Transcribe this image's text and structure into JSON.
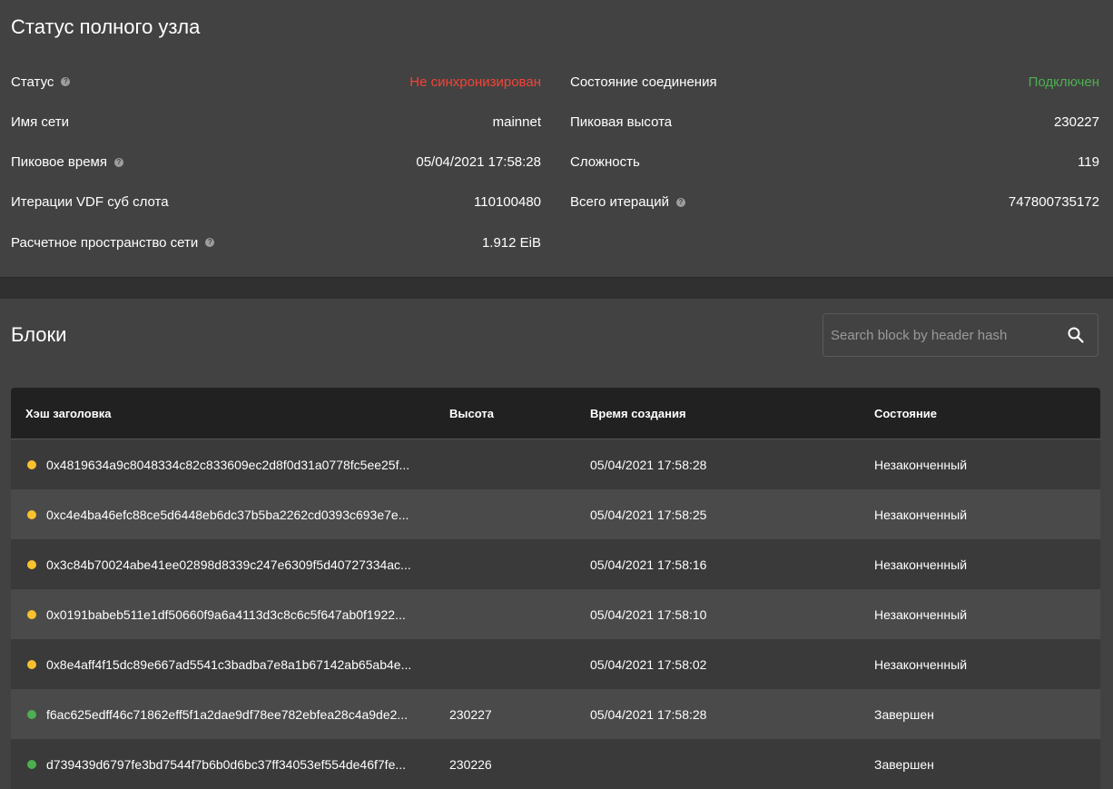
{
  "full_node": {
    "title": "Статус полного узла",
    "left": [
      {
        "label": "Статус",
        "help": true,
        "value": "Не синхронизирован",
        "tone": "red"
      },
      {
        "label": "Имя сети",
        "help": false,
        "value": "mainnet",
        "tone": "normal"
      },
      {
        "label": "Пиковое время",
        "help": true,
        "value": "05/04/2021 17:58:28",
        "tone": "normal"
      },
      {
        "label": "Итерации VDF суб слота",
        "help": false,
        "value": "110100480",
        "tone": "normal"
      },
      {
        "label": "Расчетное пространство сети",
        "help": true,
        "value": "1.912 EiB",
        "tone": "normal"
      }
    ],
    "right": [
      {
        "label": "Состояние соединения",
        "help": false,
        "value": "Подключен",
        "tone": "green"
      },
      {
        "label": "Пиковая высота",
        "help": false,
        "value": "230227",
        "tone": "normal"
      },
      {
        "label": "Сложность",
        "help": false,
        "value": "119",
        "tone": "normal"
      },
      {
        "label": "Всего итераций",
        "help": true,
        "value": "747800735172",
        "tone": "normal"
      }
    ],
    "help_glyph": "?"
  },
  "blocks": {
    "title": "Блоки",
    "search_placeholder": "Search block by header hash",
    "search_icon": "search-icon",
    "columns": {
      "hash": "Хэш заголовка",
      "height": "Высота",
      "time": "Время создания",
      "state": "Состояние"
    },
    "rows": [
      {
        "hash": "0x4819634a9c8048334c82c833609ec2d8f0d31a0778fc5ee25f...",
        "height": "",
        "time": "05/04/2021 17:58:28",
        "state": "Незаконченный",
        "dot": "#fbc02d"
      },
      {
        "hash": "0xc4e4ba46efc88ce5d6448eb6dc37b5ba2262cd0393c693e7e...",
        "height": "",
        "time": "05/04/2021 17:58:25",
        "state": "Незаконченный",
        "dot": "#fbc02d"
      },
      {
        "hash": "0x3c84b70024abe41ee02898d8339c247e6309f5d40727334ac...",
        "height": "",
        "time": "05/04/2021 17:58:16",
        "state": "Незаконченный",
        "dot": "#fbc02d"
      },
      {
        "hash": "0x0191babeb511e1df50660f9a6a4113d3c8c6c5f647ab0f1922...",
        "height": "",
        "time": "05/04/2021 17:58:10",
        "state": "Незаконченный",
        "dot": "#fbc02d"
      },
      {
        "hash": "0x8e4aff4f15dc89e667ad5541c3badba7e8a1b67142ab65ab4e...",
        "height": "",
        "time": "05/04/2021 17:58:02",
        "state": "Незаконченный",
        "dot": "#fbc02d"
      },
      {
        "hash": "f6ac625edff46c71862eff5f1a2dae9df78ee782ebfea28c4a9de2...",
        "height": "230227",
        "time": "05/04/2021 17:58:28",
        "state": "Завершен",
        "dot": "#4caf50"
      },
      {
        "hash": "d739439d6797fe3bd7544f7b6b0d6bc37ff34053ef554de46f7fe...",
        "height": "230226",
        "time": "",
        "state": "Завершен",
        "dot": "#4caf50"
      }
    ]
  },
  "colors": {
    "background": "#424242",
    "red": "#f44336",
    "green": "#4caf50",
    "pending": "#fbc02d",
    "header": "#212121"
  }
}
